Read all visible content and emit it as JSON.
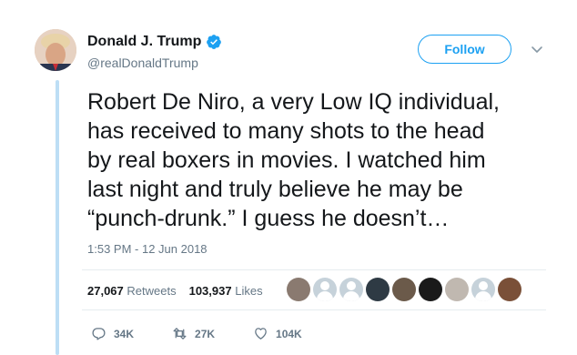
{
  "user": {
    "name": "Donald J. Trump",
    "handle": "@realDonaldTrump",
    "verified_icon": "verified-badge-icon"
  },
  "follow_button": {
    "label": "Follow"
  },
  "tweet": {
    "text": "Robert De Niro, a very Low IQ individual,\nhas received to many shots to the head\nby real boxers in movies. I watched him\nlast night and truly believe he may be\n“punch-drunk.” I guess he doesn’t…",
    "timestamp": "1:53 PM - 12 Jun 2018"
  },
  "stats": {
    "retweets_count": "27,067",
    "retweets_label": "Retweets",
    "likes_count": "103,937",
    "likes_label": "Likes"
  },
  "actions": {
    "reply_count": "34K",
    "retweet_count": "27K",
    "like_count": "104K"
  },
  "colors": {
    "accent": "#1da1f2",
    "muted": "#657786",
    "thread_line": "#bddef5"
  }
}
